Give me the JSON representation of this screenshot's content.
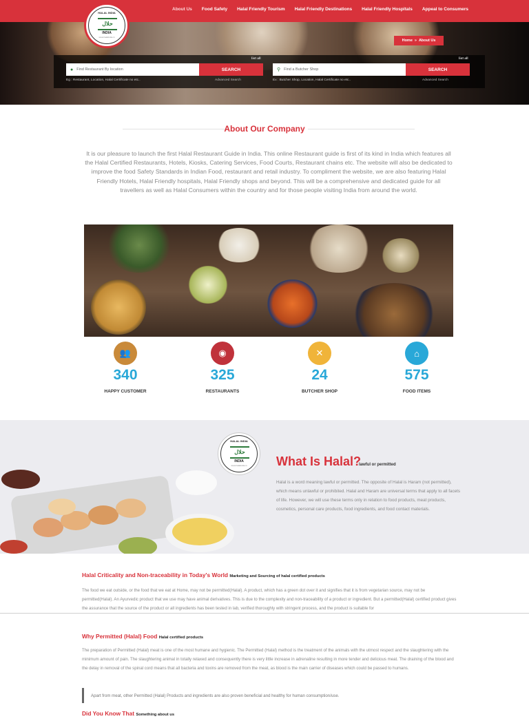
{
  "nav": {
    "items": [
      {
        "label": "About Us"
      },
      {
        "label": "Food Safety"
      },
      {
        "label": "Halal Friendly Tourism"
      },
      {
        "label": "Halal Friendly Destinations"
      },
      {
        "label": "Halal Friendly Hospitals"
      },
      {
        "label": "Appeal to Consumers"
      }
    ],
    "active": "About Us"
  },
  "logo": {
    "top": "HALAL INDIA",
    "india": "INDIA",
    "mark": "حلال",
    "tag": "www.halalindia.in"
  },
  "breadcrumb": {
    "home": "Home",
    "sep": "»",
    "current": "About Us"
  },
  "search": {
    "restaurant": {
      "list_all": "list all",
      "placeholder": "Find Restaurant By location",
      "button": "SEARCH",
      "hint": "Eg : Restaurant, Location, Halal Certificate no etc..",
      "advanced": "Advanced Search"
    },
    "butcher": {
      "list_all": "list all",
      "placeholder": "Find a Butcher Shop",
      "button": "SEARCH",
      "hint": "Ex : Butcher Shop, Location, Halal Certificate no etc..",
      "advanced": "Advanced Search"
    }
  },
  "about": {
    "title": "About Our Company",
    "text": "It is our pleasure to launch the first Halal Restaurant Guide in India. This online Restaurant guide is first of its kind in India which features all the Halal Certified Restaurants, Hotels, Kiosks, Catering Services, Food Courts, Restaurant chains etc. The website will also be dedicated to improve the food Safety Standards in Indian Food, restaurant and retail industry. To compliment the website, we are also featuring Halal Friendly Hotels, Halal Friendly hospitals, Halal Friendly shops and beyond. This will be a comprehensive and dedicated guide for all travellers as well as Halal Consumers within the country and for those people visiting India from around the world."
  },
  "stats": [
    {
      "value": "340",
      "label": "HAPPY CUSTOMER",
      "color": "#c98a3a",
      "icon": "people-icon",
      "glyph": "👥"
    },
    {
      "value": "325",
      "label": "RESTAURANTS",
      "color": "#c0323b",
      "icon": "plate-icon",
      "glyph": "🍽"
    },
    {
      "value": "24",
      "label": "BUTCHER SHOP",
      "color": "#f0b43a",
      "icon": "knives-icon",
      "glyph": "✕"
    },
    {
      "value": "575",
      "label": "FOOD ITEMS",
      "color": "#29a8d8",
      "icon": "cloche-icon",
      "glyph": "⌂"
    }
  ],
  "halal": {
    "title": "What Is Halal?",
    "subtitle": "lawful or permitted",
    "text": "Halal is a word meaning lawful or permitted. The opposite of Halal is Haram (not permitted), which means unlawful or prohibited. Halal and Haram are universal terms that apply to all facets of life. However, we will use these terms only in relation to food products, meat products, cosmetics, personal care products, food ingredients, and food contact materials."
  },
  "articles": {
    "a1": {
      "title": "Halal Criticality and Non-traceability in Today's World",
      "small": "Marketing and Sourcing of halal certified products",
      "text": "The food we eat outside, or the food that we eat at Home, may not be permitted(Halal). A product, which has a green dot over it and signifies that it is from vegetarian source, may not be permitted(Halal). An Ayurvedic product that we use may have animal derivatives. This is due to the complexity and non-traceability of a product or ingredient. But a permitted(Halal) certified product gives the assurance that the source of the product or all ingredients has been tested in lab, verified thoroughly with stringent process, and the product is suitable for"
    },
    "a2": {
      "title": "Why Permitted (Halal) Food",
      "small": "Halal certified products",
      "text": "The preparation of Permitted (Halal) meat is one of the most humane and hygienic. The Permitted (Halal) method is the treatment of the animals with the utmost respect and the slaughtering with the minimum amount of pain. The slaughtering animal in totally relaxed and consequently there is very little increase in adrenaline resulting in more tender and delicious meat. The draining of the blood and the delay in removal of the spinal cord means that all bacteria and toxins are removed from the meat, as blood is the main carrier of diseases which could be passed to humans.",
      "quote": "Apart from meat, other Permitted (Halal) Products and ingredients are also proven beneficial and healthy for human consumption/use."
    },
    "a3": {
      "title": "Did You Know That",
      "small": "Something about us"
    }
  }
}
